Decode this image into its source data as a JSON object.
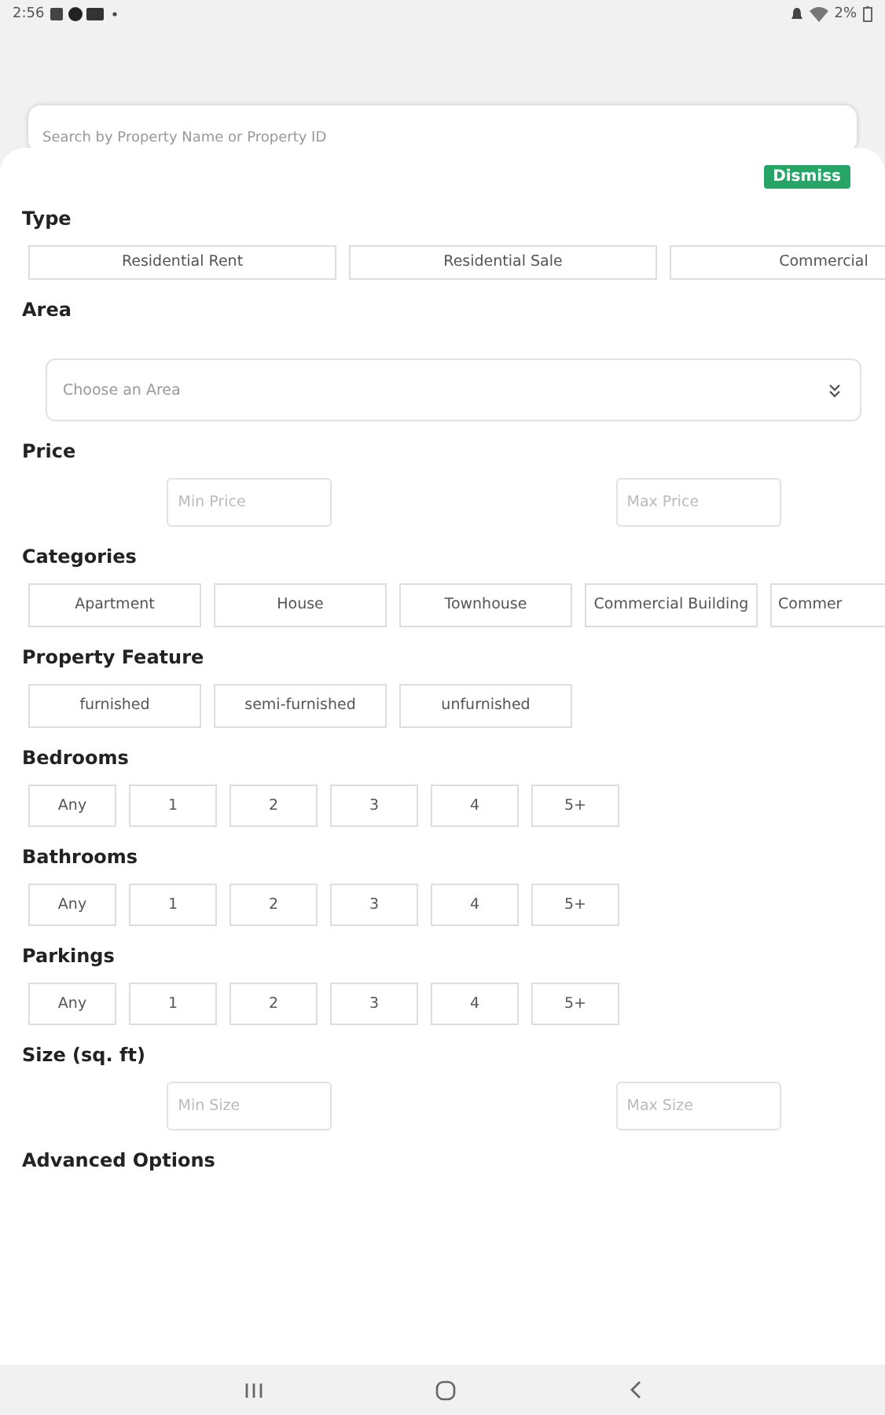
{
  "status_bar": {
    "time": "2:56",
    "battery": "2%"
  },
  "search": {
    "placeholder": "Search by Property Name or Property ID"
  },
  "dismiss": "Dismiss",
  "sections": [
    {
      "kind": "wide_chips",
      "title": "Type",
      "options": [
        "Residential Rent",
        "Residential Sale",
        "Commercial"
      ]
    },
    {
      "kind": "dropdown",
      "title": "Area",
      "placeholder": "Choose an Area"
    },
    {
      "kind": "range",
      "title": "Price",
      "min_placeholder": "Min Price",
      "max_placeholder": "Max Price"
    },
    {
      "kind": "chips",
      "title": "Categories",
      "options": [
        "Apartment",
        "House",
        "Townhouse",
        "Commercial Building",
        "Commer"
      ]
    },
    {
      "kind": "chips",
      "title": "Property Feature",
      "options": [
        "furnished",
        "semi-furnished",
        "unfurnished"
      ]
    },
    {
      "kind": "small_chips",
      "title": "Bedrooms",
      "options": [
        "Any",
        "1",
        "2",
        "3",
        "4",
        "5+"
      ]
    },
    {
      "kind": "small_chips",
      "title": "Bathrooms",
      "options": [
        "Any",
        "1",
        "2",
        "3",
        "4",
        "5+"
      ]
    },
    {
      "kind": "small_chips",
      "title": "Parkings",
      "options": [
        "Any",
        "1",
        "2",
        "3",
        "4",
        "5+"
      ]
    },
    {
      "kind": "range",
      "title": "Size (sq. ft)",
      "min_placeholder": "Min Size",
      "max_placeholder": "Max Size"
    },
    {
      "kind": "heading",
      "title": "Advanced Options"
    }
  ]
}
